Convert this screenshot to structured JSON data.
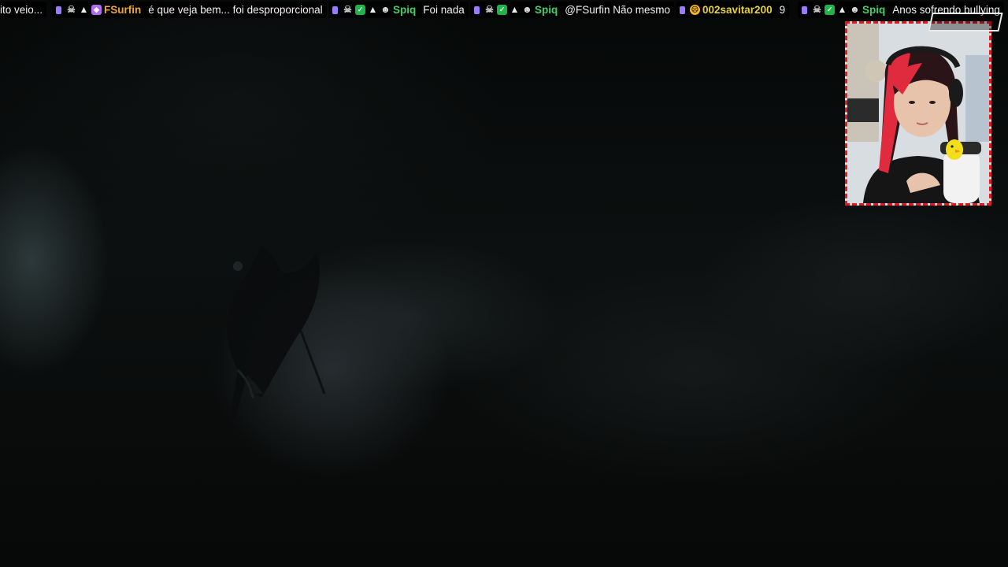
{
  "chat": {
    "messages": [
      {
        "username": "",
        "name_color": "#f2f2f2",
        "text": "ito veio...",
        "badges": []
      },
      {
        "username": "FSurfin",
        "name_color": "#f0a43a",
        "text": "é que veja bem... foi desproporcional",
        "badges": [
          "sub-icon",
          "glitch-icon",
          "hat-icon",
          "gift-icon"
        ]
      },
      {
        "username": "Spiq",
        "name_color": "#3fd16b",
        "text": "Foi nada",
        "badges": [
          "sub-icon",
          "glitch-icon",
          "mod-icon",
          "hat-icon",
          "skull-icon"
        ]
      },
      {
        "username": "Spiq",
        "name_color": "#3fd16b",
        "text": "@FSurfin Não mesmo",
        "badges": [
          "sub-icon",
          "glitch-icon",
          "mod-icon",
          "hat-icon",
          "skull-icon"
        ]
      },
      {
        "username": "002savitar200",
        "name_color": "#e7d23a",
        "text": "9",
        "badges": [
          "sub-icon",
          "prediction-icon"
        ]
      },
      {
        "username": "Spiq",
        "name_color": "#3fd16b",
        "text": "Anos sofrendo bullying",
        "badges": [
          "sub-icon",
          "glitch-icon",
          "mod-icon",
          "hat-icon",
          "skull-icon"
        ]
      }
    ]
  },
  "colors": {
    "webcam_border": "#e3191f",
    "ticker_background": "#000000",
    "hair_red": "#e02a3d"
  }
}
